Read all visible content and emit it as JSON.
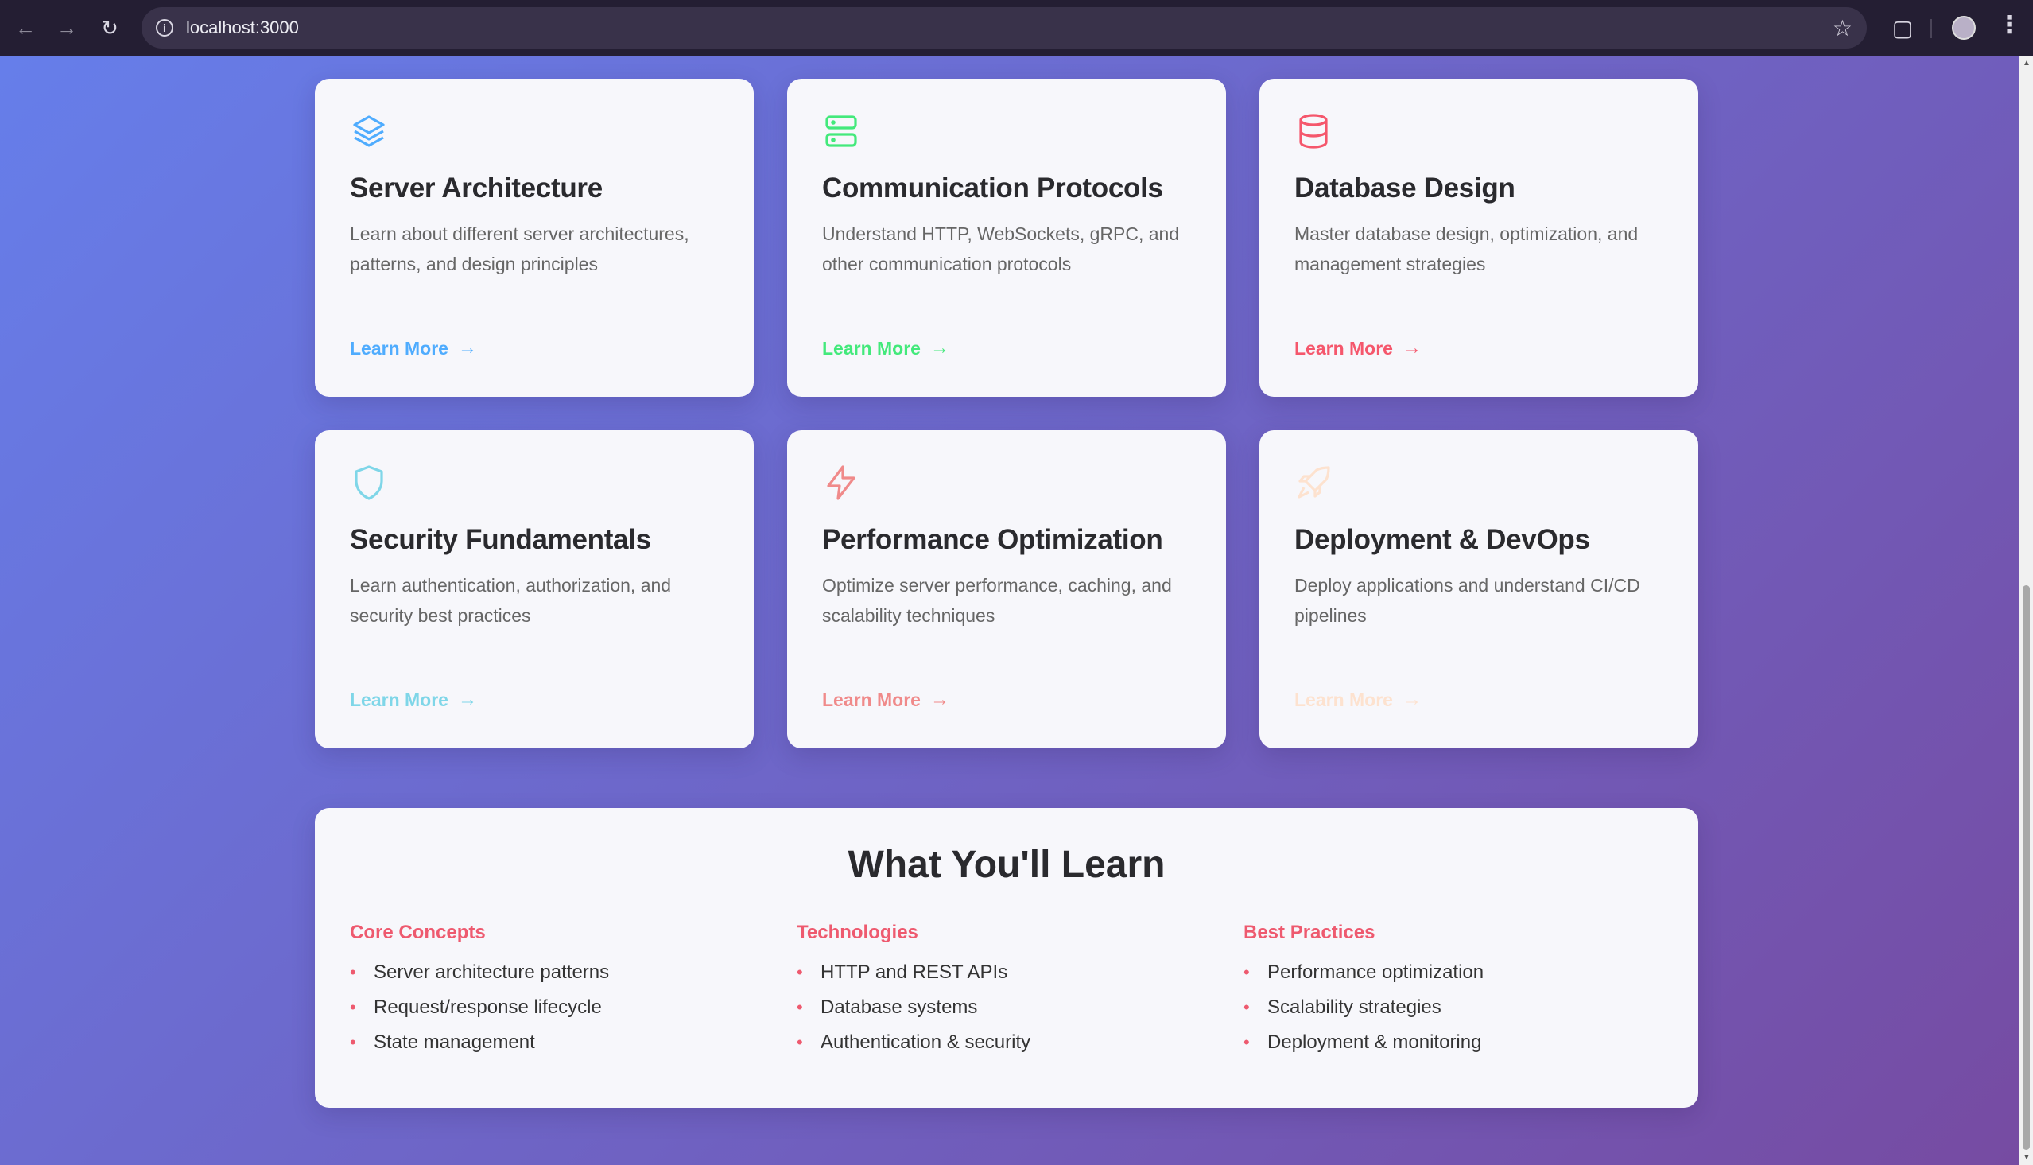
{
  "browser": {
    "url": "localhost:3000"
  },
  "cards": [
    {
      "title": "Server Architecture",
      "description": "Learn about different server architectures, patterns, and design principles",
      "link": "Learn More",
      "icon": "layers-icon",
      "color": "#4facfe",
      "opacity": 1
    },
    {
      "title": "Communication Protocols",
      "description": "Understand HTTP, WebSockets, gRPC, and other communication protocols",
      "link": "Learn More",
      "icon": "server-icon",
      "color": "#43e97b",
      "opacity": 1
    },
    {
      "title": "Database Design",
      "description": "Master database design, optimization, and management strategies",
      "link": "Learn More",
      "icon": "database-icon",
      "color": "#f5576c",
      "opacity": 1
    },
    {
      "title": "Security Fundamentals",
      "description": "Learn authentication, authorization, and security best practices",
      "link": "Learn More",
      "icon": "shield-icon",
      "color": "#7fd6e8",
      "opacity": 1
    },
    {
      "title": "Performance Optimization",
      "description": "Optimize server performance, caching, and scalability techniques",
      "link": "Learn More",
      "icon": "lightning-icon",
      "color": "#f08a8a",
      "opacity": 1
    },
    {
      "title": "Deployment & DevOps",
      "description": "Deploy applications and understand CI/CD pipelines",
      "link": "Learn More",
      "icon": "rocket-icon",
      "color": "#fde2cf",
      "opacity": 1
    }
  ],
  "learn": {
    "title": "What You'll Learn",
    "columns": [
      {
        "heading": "Core Concepts",
        "items": [
          "Server architecture patterns",
          "Request/response lifecycle",
          "State management"
        ]
      },
      {
        "heading": "Technologies",
        "items": [
          "HTTP and REST APIs",
          "Database systems",
          "Authentication & security"
        ]
      },
      {
        "heading": "Best Practices",
        "items": [
          "Performance optimization",
          "Scalability strategies",
          "Deployment & monitoring"
        ]
      }
    ]
  }
}
